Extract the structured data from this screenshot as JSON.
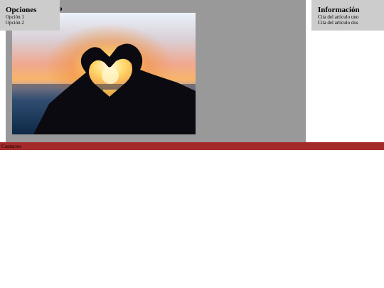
{
  "main": {
    "title": "do"
  },
  "left_panel": {
    "title": "Opciones",
    "items": [
      "Opción 1",
      "Opción 2"
    ]
  },
  "right_panel": {
    "title": "Información",
    "items": [
      "Cita del artículo uno",
      "Cita del artículo dos"
    ]
  },
  "footer": {
    "label": "Contactos"
  },
  "colors": {
    "main_bg": "#999999",
    "panel_bg": "#cccccc",
    "footer_bg": "#a52a2a"
  },
  "image": {
    "subject": "heart-hands-sunset-photo"
  }
}
